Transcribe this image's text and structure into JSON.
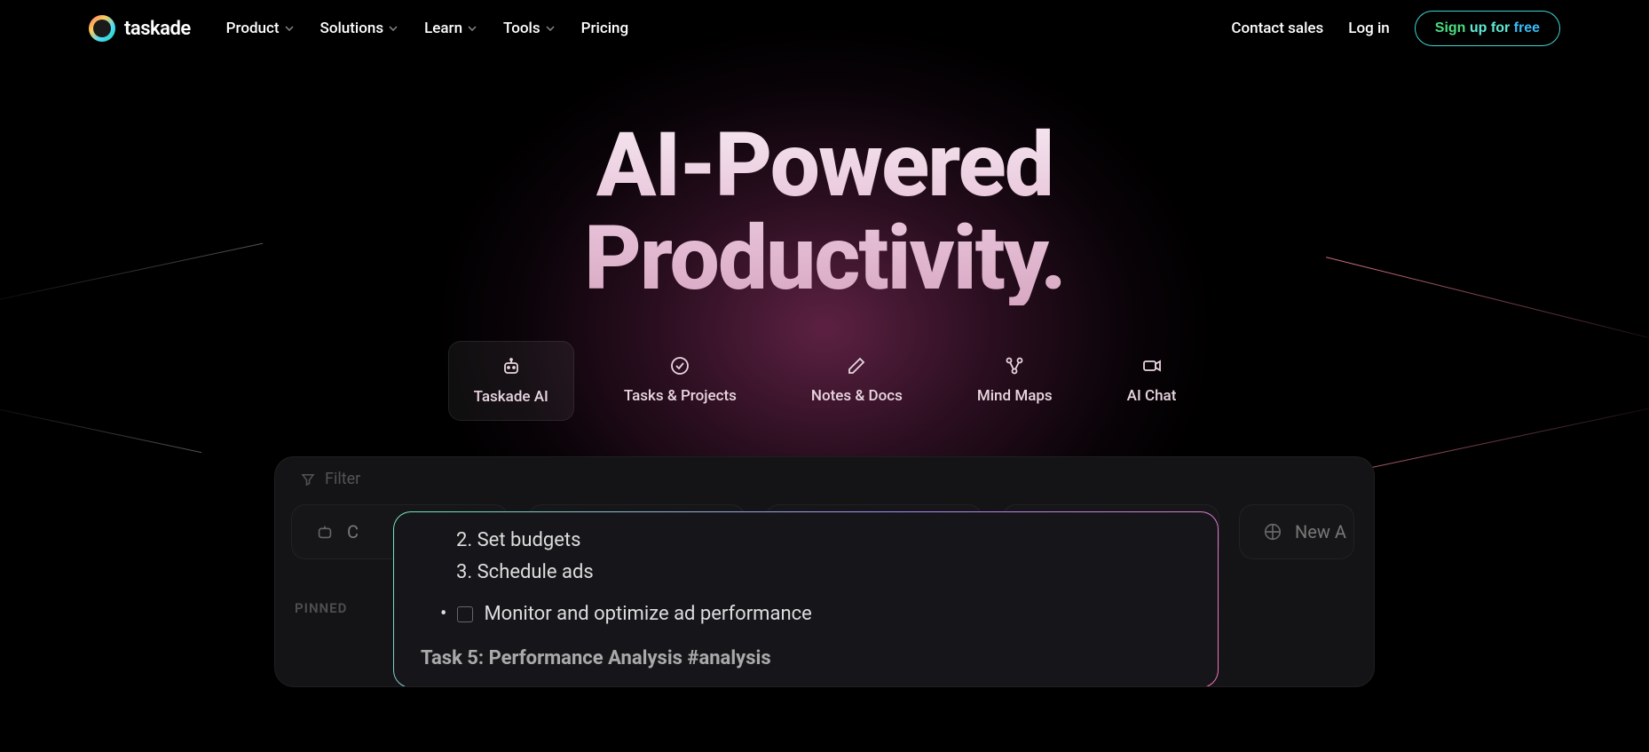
{
  "brand": "taskade",
  "nav": {
    "items": [
      {
        "label": "Product",
        "hasDropdown": true
      },
      {
        "label": "Solutions",
        "hasDropdown": true
      },
      {
        "label": "Learn",
        "hasDropdown": true
      },
      {
        "label": "Tools",
        "hasDropdown": true
      },
      {
        "label": "Pricing",
        "hasDropdown": false
      }
    ]
  },
  "header": {
    "contact": "Contact sales",
    "login": "Log in",
    "signup": "Sign up for free"
  },
  "hero": {
    "line1": "AI-Powered",
    "line2": "Productivity."
  },
  "tabs": [
    {
      "label": "Taskade AI",
      "active": true
    },
    {
      "label": "Tasks & Projects",
      "active": false
    },
    {
      "label": "Notes & Docs",
      "active": false
    },
    {
      "label": "Mind Maps",
      "active": false
    },
    {
      "label": "AI Chat",
      "active": false
    }
  ],
  "preview": {
    "filter": "Filter",
    "pill_c_partial": "C",
    "pill_new_partial": "New A",
    "pinned": "PINNED",
    "tasks": {
      "item2": "2. Set budgets",
      "item3": "3. Schedule ads",
      "bullet1": "Monitor and optimize ad performance",
      "heading_partial": "Task 5: Performance Analysis #analysis"
    }
  }
}
